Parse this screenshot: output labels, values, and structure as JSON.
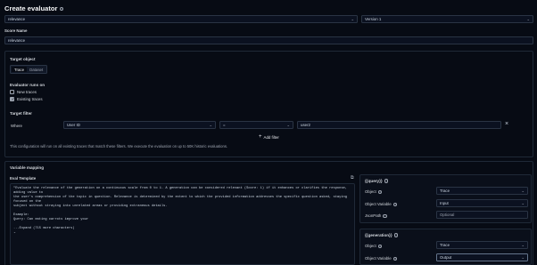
{
  "header": {
    "title": "Create evaluator",
    "info_icon": "ⓘ"
  },
  "evaluator": {
    "selected": "relevance",
    "version": "Version 1"
  },
  "score_name": {
    "label": "Score Name",
    "value": "relevance"
  },
  "target": {
    "label": "Target object",
    "tabs": [
      "Trace",
      "Dataset"
    ],
    "active_tab": "Trace"
  },
  "runs_on": {
    "label": "Evaluator runs on",
    "options": [
      {
        "label": "New traces",
        "checked": false
      },
      {
        "label": "Existing traces",
        "checked": true
      }
    ]
  },
  "filter": {
    "label": "Target filter",
    "where": "Where",
    "column": "User ID",
    "operator": "=",
    "value": "user2",
    "add_label": "Add filter",
    "remove_icon": "×",
    "note": "This configuration will run on all existing traces that match these filters. We execute the evaluation on up to 50K historic evaluations."
  },
  "mapping": {
    "label": "Variable mapping",
    "template_label": "Eval Template",
    "copy_icon": "⧉",
    "template_lines": [
      "\"Evaluate the relevance of the generation on a continuous scale from 0 to 1. A generation can be considered relevant (Score: 1) if it enhances or clarifies the response, adding value to",
      "the user's comprehension of the topic in question. Relevance is determined by the extent to which the provided information addresses the specific question asked, staying focused on the",
      "subject without straying into unrelated areas or providing extraneous details.",
      "",
      "Example:",
      "Query: Can eating carrots improve your",
      "",
      "...Expand (715 more characters)"
    ],
    "query": {
      "title": "{{query}}",
      "object_label": "Object",
      "object_value": "Trace",
      "variable_label": "Object Variable",
      "variable_value": "Input",
      "jsonpath_label": "JsonPath",
      "jsonpath_placeholder": "Optional"
    },
    "generation": {
      "title": "{{generation}}",
      "object_label": "Object",
      "object_value": "Trace",
      "variable_label": "Object Variable",
      "variable_value": "Output"
    }
  }
}
